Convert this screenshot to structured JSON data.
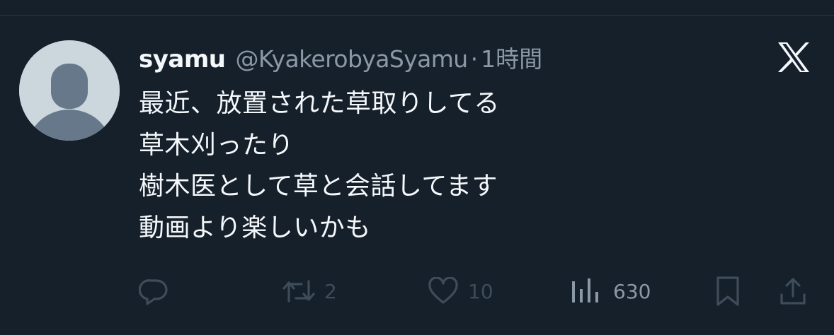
{
  "tweet": {
    "display_name": "syamu",
    "handle": "@KyakerobyaSyamu",
    "separator": "·",
    "time": "1時間",
    "lines": [
      "最近、放置された草取りしてる",
      "草木刈ったり",
      "樹木医として草と会話してます",
      "動画より楽しいかも"
    ]
  },
  "actions": {
    "reply_icon": "reply-icon",
    "retweet_icon": "retweet-icon",
    "retweet_count": "2",
    "like_icon": "heart-icon",
    "like_count": "10",
    "views_icon": "views-icon",
    "views_count": "630",
    "bookmark_icon": "bookmark-icon",
    "share_icon": "share-icon"
  },
  "colors": {
    "background": "#15202b",
    "primary_text": "#f5f8fa",
    "secondary_text": "#8b98a5",
    "dimmed_icon": "#3f4c59",
    "avatar_bg": "#ccd6dd",
    "avatar_figure": "#66788a"
  }
}
